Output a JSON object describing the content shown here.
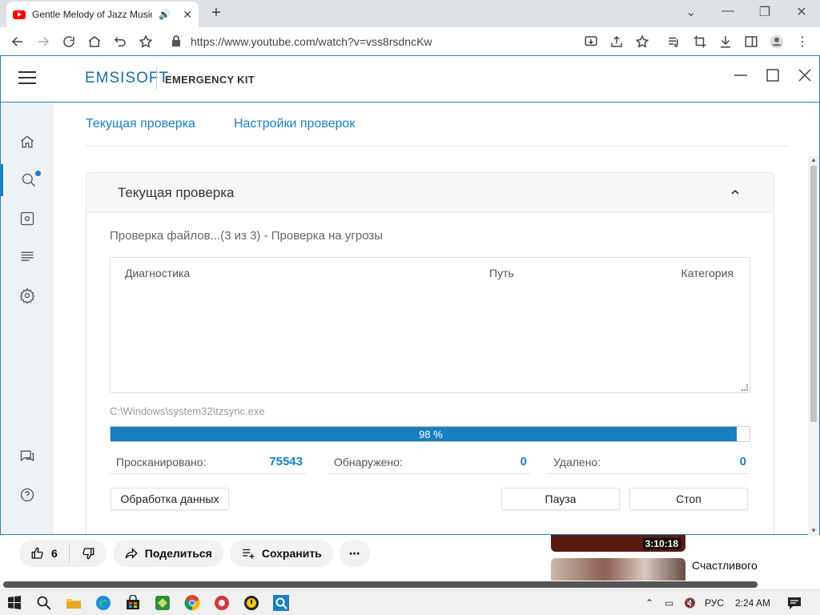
{
  "browser": {
    "tab_title": "Gentle Melody of Jazz Music in",
    "audio_icon": "speaker-icon",
    "close_glyph": "✕",
    "new_tab_glyph": "+",
    "url": "https://www.youtube.com/watch?v=vss8rsdncKw",
    "window_controls": {
      "minimize": "—",
      "restore": "❐",
      "close": "✕"
    }
  },
  "app": {
    "logo": "EMSISOFT",
    "product": "EMERGENCY KIT",
    "subnav": [
      "Текущая проверка",
      "Настройки проверок"
    ],
    "panel_title": "Текущая проверка",
    "status": "Проверка файлов...(3 из 3) - Проверка на угрозы",
    "columns": {
      "diag": "Диагностика",
      "path": "Путь",
      "category": "Категория"
    },
    "current_file": "C:\\Windows\\system32\\tzsync.exe",
    "progress": {
      "percent": 98,
      "label": "98 %"
    },
    "stats": {
      "scanned_label": "Просканировано:",
      "scanned_value": "75543",
      "detected_label": "Обнаружено:",
      "detected_value": "0",
      "removed_label": "Удалено:",
      "removed_value": "0"
    },
    "buttons": {
      "process": "Обработка данных",
      "pause": "Пауза",
      "stop": "Стоп"
    },
    "accent": "#1a7fc1"
  },
  "youtube": {
    "likes": "6",
    "share": "Поделиться",
    "save": "Сохранить",
    "more": "⋯",
    "thumb_duration": "3:10:18",
    "rec_title": "Счастливого"
  },
  "taskbar": {
    "lang": "РУС",
    "time": "2:24 AM"
  }
}
